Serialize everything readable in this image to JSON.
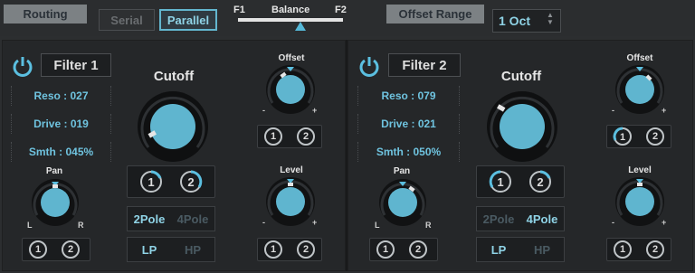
{
  "topbar": {
    "routing_label": "Routing",
    "serial_label": "Serial",
    "parallel_label": "Parallel",
    "balance_label": "Balance",
    "f1_label": "F1",
    "f2_label": "F2",
    "offset_range_label": "Offset Range",
    "offset_range_value": "1 Oct"
  },
  "filters": [
    {
      "name": "Filter 1",
      "reso": "Reso : 027",
      "drive": "Drive : 019",
      "smth": "Smth : 045%",
      "cutoff_label": "Cutoff",
      "pan_label": "Pan",
      "pan_l": "L",
      "pan_r": "R",
      "offset_label": "Offset",
      "level_label": "Level",
      "minus": "-",
      "plus": "+",
      "one": "1",
      "two": "2",
      "pole_2": "2Pole",
      "pole_4": "4Pole",
      "lp": "LP",
      "hp": "HP",
      "pole_selected": "2Pole",
      "mode_selected": "LP"
    },
    {
      "name": "Filter 2",
      "reso": "Reso : 079",
      "drive": "Drive : 021",
      "smth": "Smth : 050%",
      "cutoff_label": "Cutoff",
      "pan_label": "Pan",
      "pan_l": "L",
      "pan_r": "R",
      "offset_label": "Offset",
      "level_label": "Level",
      "minus": "-",
      "plus": "+",
      "one": "1",
      "two": "2",
      "pole_2": "2Pole",
      "pole_4": "4Pole",
      "lp": "LP",
      "hp": "HP",
      "pole_selected": "4Pole",
      "mode_selected": "LP"
    }
  ],
  "colors": {
    "accent": "#5bbfe0",
    "knob": "#5fb5cf",
    "panel": "#252729"
  }
}
